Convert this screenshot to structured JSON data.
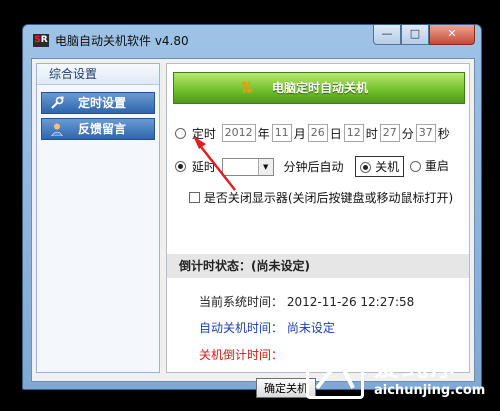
{
  "window": {
    "title": "电脑自动关机软件 v4.80",
    "icon_text_a": "S",
    "icon_text_b": "R",
    "minimize_glyph": "—",
    "maximize_glyph": "□",
    "close_glyph": "✕"
  },
  "sidebar": {
    "header": "综合设置",
    "items": [
      {
        "label": "定时设置",
        "icon": "wrench-icon"
      },
      {
        "label": "反馈留言",
        "icon": "user-icon"
      }
    ]
  },
  "banner": {
    "title": "电脑定时自动关机",
    "icon": "up-down-arrows-icon"
  },
  "timed": {
    "label": "定时",
    "year": "2012",
    "year_unit": "年",
    "month": "11",
    "month_unit": "月",
    "day": "26",
    "day_unit": "日",
    "hour": "12",
    "hour_unit": "时",
    "minute": "27",
    "minute_unit": "分",
    "second": "37",
    "second_unit": "秒"
  },
  "delay": {
    "label": "延时",
    "minutes_value": "",
    "after_text": "分钟后自动",
    "shutdown_label": "关机",
    "restart_label": "重启"
  },
  "monitor_option": {
    "label": "是否关闭显示器(关闭后按键盘或移动鼠标打开)"
  },
  "status": {
    "header": "倒计时状态：(尚未设定)",
    "current_time_label": "当前系统时间：",
    "current_time_value": "2012-11-26 12:27:58",
    "auto_shutdown_label": "自动关机时间：",
    "auto_shutdown_value": "尚未设定",
    "countdown_label": "关机倒计时间："
  },
  "buttons": {
    "confirm": "确定关机"
  },
  "watermark": {
    "title": "爱纯净",
    "url": "aichunjing.com"
  },
  "colors": {
    "accent_green": "#6fbd2a",
    "nav_blue": "#2e66ab",
    "annotation_red": "#e02020"
  }
}
